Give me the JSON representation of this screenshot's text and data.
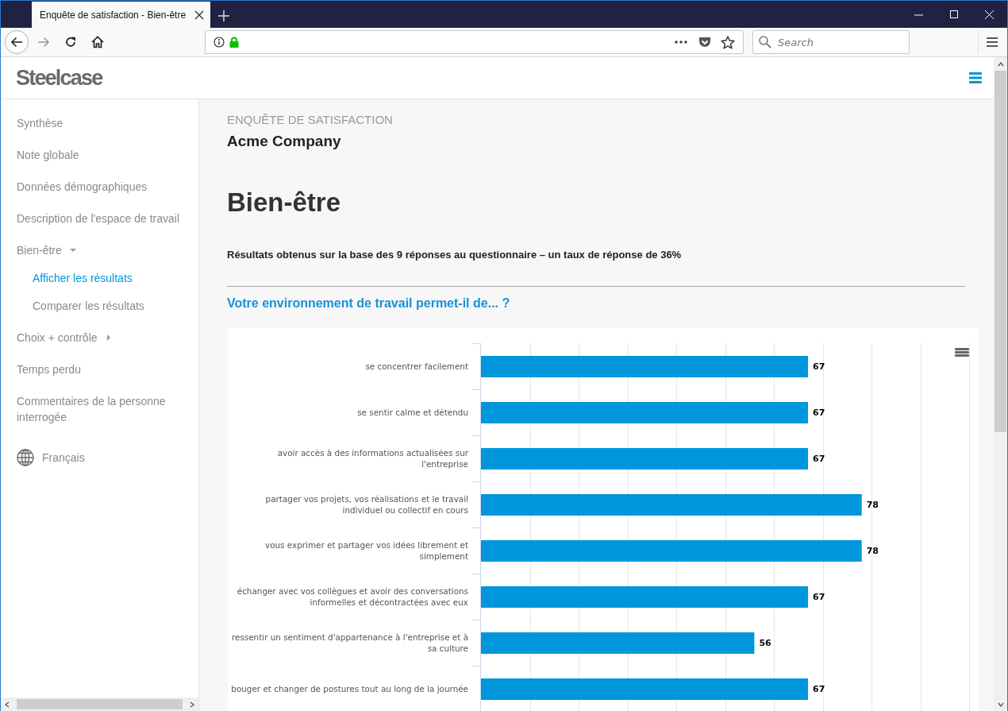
{
  "browser": {
    "tab_title": "Enquête de satisfaction - Bien-être",
    "search_placeholder": "Search"
  },
  "header": {
    "logo": "Steelcase"
  },
  "sidebar": {
    "items": [
      {
        "label": "Synthèse",
        "selected": false
      },
      {
        "label": "Note globale",
        "selected": false
      },
      {
        "label": "Données démographiques",
        "selected": false
      },
      {
        "label": "Description de l'espace de travail",
        "selected": false
      },
      {
        "label": "Bien-être",
        "selected": false,
        "expanded": true,
        "children": [
          {
            "label": "Afficher les résultats",
            "selected": true
          },
          {
            "label": "Comparer les résultats",
            "selected": false
          }
        ]
      },
      {
        "label": "Choix + contrôle",
        "selected": false,
        "expanded": false
      },
      {
        "label": "Temps perdu",
        "selected": false
      },
      {
        "label": "Commentaires de la personne interrogée",
        "selected": false
      }
    ],
    "language": "Français"
  },
  "main": {
    "eyebrow": "ENQUÊTE DE SATISFACTION",
    "company": "Acme Company",
    "title": "Bien-être",
    "summary": "Résultats obtenus sur la base des 9 réponses au questionnaire – un taux de réponse de 36%",
    "question": "Votre environnement de travail permet-il de... ?",
    "chart_data": {
      "type": "bar",
      "orientation": "horizontal",
      "categories": [
        "se concentrer facilement",
        "se sentir calme et détendu",
        "avoir accès à des informations actualisées sur l'entreprise",
        "partager vos projets, vos réalisations et le travail individuel ou collectif en cours",
        "vous exprimer et partager vos idées librement et simplement",
        "échanger avec vos collègues et avoir des conversations informelles et décontractées avec eux",
        "ressentir un sentiment d'appartenance à l'entreprise et à sa culture",
        "bouger et changer de postures tout au long de la journée"
      ],
      "series": [
        {
          "color": "#0096db",
          "values": [
            67,
            67,
            67,
            78,
            78,
            67,
            56,
            67
          ]
        }
      ],
      "xlim": [
        0,
        100
      ],
      "data_labels": true
    }
  }
}
